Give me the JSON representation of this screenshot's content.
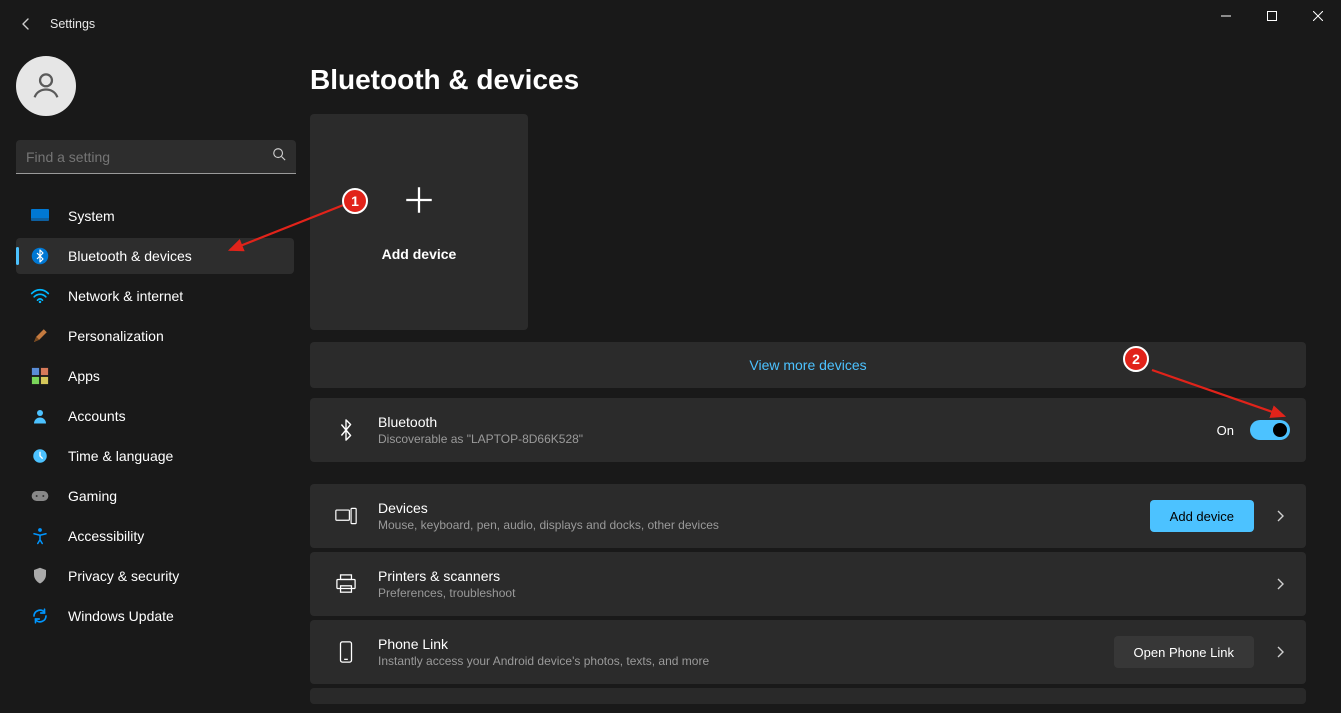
{
  "window": {
    "title": "Settings"
  },
  "search": {
    "placeholder": "Find a setting"
  },
  "sidebar": {
    "items": [
      {
        "label": "System"
      },
      {
        "label": "Bluetooth & devices"
      },
      {
        "label": "Network & internet"
      },
      {
        "label": "Personalization"
      },
      {
        "label": "Apps"
      },
      {
        "label": "Accounts"
      },
      {
        "label": "Time & language"
      },
      {
        "label": "Gaming"
      },
      {
        "label": "Accessibility"
      },
      {
        "label": "Privacy & security"
      },
      {
        "label": "Windows Update"
      }
    ],
    "active_index": 1
  },
  "page": {
    "title": "Bluetooth & devices",
    "add_device_tile": "Add device",
    "view_more": "View more devices",
    "bluetooth_row": {
      "title": "Bluetooth",
      "subtitle": "Discoverable as \"LAPTOP-8D66K528\"",
      "state_label": "On",
      "state_on": true
    },
    "devices_row": {
      "title": "Devices",
      "subtitle": "Mouse, keyboard, pen, audio, displays and docks, other devices",
      "button": "Add device"
    },
    "printers_row": {
      "title": "Printers & scanners",
      "subtitle": "Preferences, troubleshoot"
    },
    "phone_row": {
      "title": "Phone Link",
      "subtitle": "Instantly access your Android device's photos, texts, and more",
      "button": "Open Phone Link"
    }
  },
  "annotations": {
    "badge1": "1",
    "badge2": "2"
  }
}
